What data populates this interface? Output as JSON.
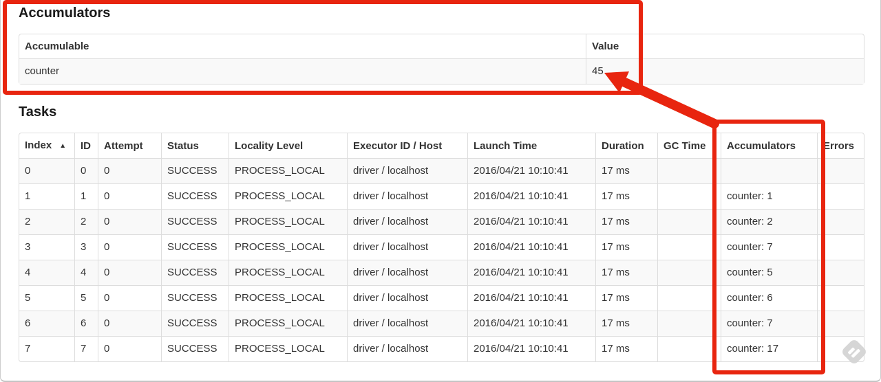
{
  "accumulators_section": {
    "title": "Accumulators",
    "table": {
      "headers": [
        "Accumulable",
        "Value"
      ],
      "rows": [
        [
          "counter",
          "45"
        ]
      ]
    }
  },
  "tasks_section": {
    "title": "Tasks",
    "table": {
      "sort_icon": "▲",
      "headers": [
        "Index",
        "ID",
        "Attempt",
        "Status",
        "Locality Level",
        "Executor ID / Host",
        "Launch Time",
        "Duration",
        "GC Time",
        "Accumulators",
        "Errors"
      ],
      "rows": [
        [
          "0",
          "0",
          "0",
          "SUCCESS",
          "PROCESS_LOCAL",
          "driver / localhost",
          "2016/04/21 10:10:41",
          "17 ms",
          "",
          "",
          ""
        ],
        [
          "1",
          "1",
          "0",
          "SUCCESS",
          "PROCESS_LOCAL",
          "driver / localhost",
          "2016/04/21 10:10:41",
          "17 ms",
          "",
          "counter: 1",
          ""
        ],
        [
          "2",
          "2",
          "0",
          "SUCCESS",
          "PROCESS_LOCAL",
          "driver / localhost",
          "2016/04/21 10:10:41",
          "17 ms",
          "",
          "counter: 2",
          ""
        ],
        [
          "3",
          "3",
          "0",
          "SUCCESS",
          "PROCESS_LOCAL",
          "driver / localhost",
          "2016/04/21 10:10:41",
          "17 ms",
          "",
          "counter: 7",
          ""
        ],
        [
          "4",
          "4",
          "0",
          "SUCCESS",
          "PROCESS_LOCAL",
          "driver / localhost",
          "2016/04/21 10:10:41",
          "17 ms",
          "",
          "counter: 5",
          ""
        ],
        [
          "5",
          "5",
          "0",
          "SUCCESS",
          "PROCESS_LOCAL",
          "driver / localhost",
          "2016/04/21 10:10:41",
          "17 ms",
          "",
          "counter: 6",
          ""
        ],
        [
          "6",
          "6",
          "0",
          "SUCCESS",
          "PROCESS_LOCAL",
          "driver / localhost",
          "2016/04/21 10:10:41",
          "17 ms",
          "",
          "counter: 7",
          ""
        ],
        [
          "7",
          "7",
          "0",
          "SUCCESS",
          "PROCESS_LOCAL",
          "driver / localhost",
          "2016/04/21 10:10:41",
          "17 ms",
          "",
          "counter: 17",
          ""
        ]
      ]
    }
  },
  "annotations": {
    "color": "#e8250f"
  }
}
